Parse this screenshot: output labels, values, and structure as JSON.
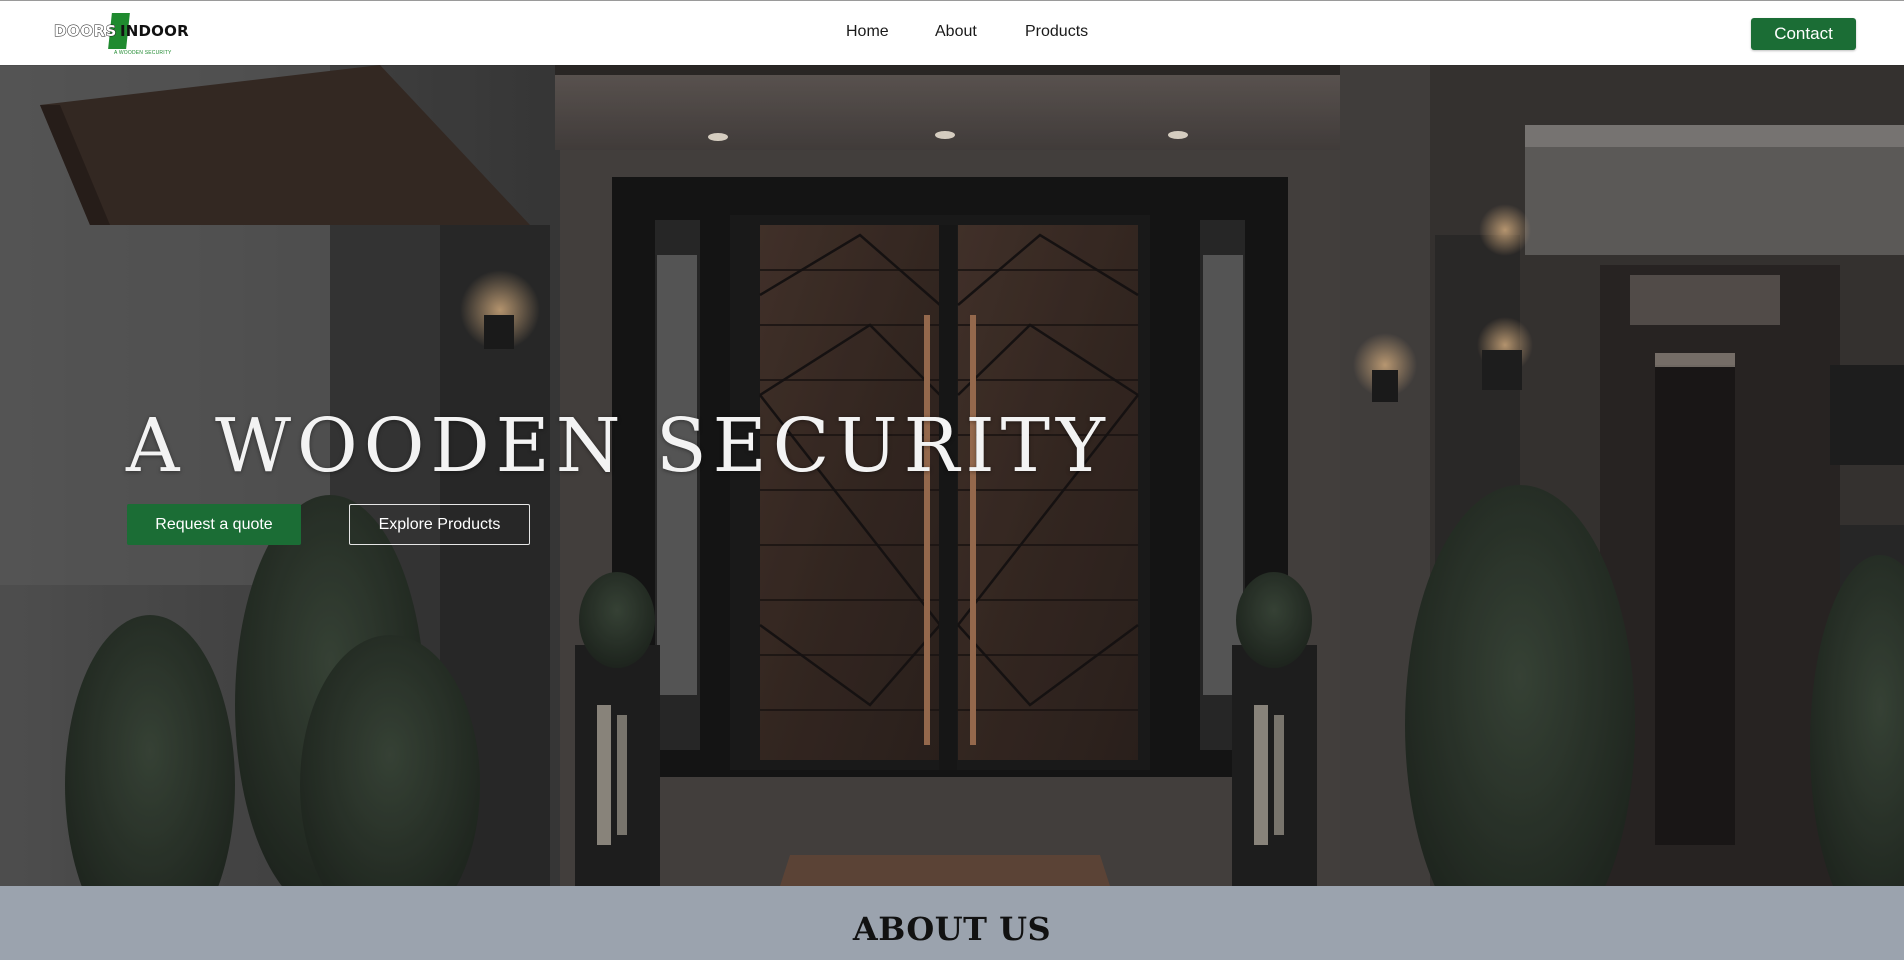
{
  "header": {
    "logo": {
      "word_left": "DOORS",
      "word_right": "INDOOR",
      "tagline": "A WOODEN SECURITY"
    },
    "nav": [
      {
        "label": "Home"
      },
      {
        "label": "About"
      },
      {
        "label": "Products"
      }
    ],
    "contact_label": "Contact"
  },
  "hero": {
    "title": "A WOODEN SECURITY",
    "primary_button": "Request a quote",
    "secondary_button": "Explore Products",
    "background_image": "modern-house-entrance-wooden-double-door"
  },
  "about": {
    "title": "ABOUT US"
  },
  "colors": {
    "brand_green": "#1b6d35",
    "logo_green": "#1f8a2f",
    "about_background": "#9ba3ae"
  }
}
